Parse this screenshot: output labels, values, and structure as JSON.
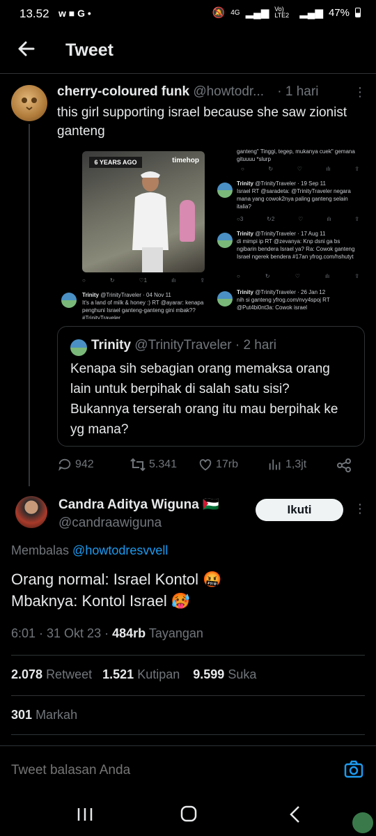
{
  "status_bar": {
    "time": "13.52",
    "left_icons": "w ■ G •",
    "network": "4G",
    "volte": "Vo) LTE2",
    "battery": "47%"
  },
  "header": {
    "title": "Tweet"
  },
  "tweet1": {
    "name": "cherry-coloured funk",
    "handle": "@howtodr...",
    "time": "· 1 hari",
    "text": "this girl supporting israel because she saw zionist ganteng"
  },
  "media": {
    "badge": "6 YEARS AGO",
    "brand": "timehop",
    "top_text": "ganteng\" Tinggi, tegep, mukanya cuek\" gemana gituuuu *slurp",
    "mini_tweets": [
      {
        "name": "Trinity",
        "handle": "@TrinityTraveler · 19 Sep 11",
        "text": "Israel RT @saradeta: @TrinityTraveler negara mana yang cowok2nya paling ganteng selain italia?"
      },
      {
        "name": "Trinity",
        "handle": "@TrinityTraveler · 17 Aug 11",
        "text": "di mimpi ip RT @zevanya: Knp dsni ga bs ngibarin bendera Israel ya? Ra: Cowok ganteng Israel ngerek bendera #17an yfrog.com/hshutyt"
      },
      {
        "name": "Trinity",
        "handle": "@TrinityTraveler · 26 Jan 12",
        "text": "nih si ganteng yfrog.com/nvy4spoj RT @Put4bi0nt3a: Cowok israel"
      },
      {
        "name": "Trinity",
        "handle": "@TrinityTraveler · 04 Nov 11",
        "text": "It's a land of milk & honey :) RT @ayarar: kenapa penghuni Israel ganteng-ganteng gini mbak?? #TrinityTraveler"
      }
    ],
    "counts": [
      "3",
      "2",
      "1"
    ]
  },
  "quote": {
    "name": "Trinity",
    "handle": "@TrinityTraveler",
    "time": "· 2 hari",
    "text": "Kenapa sih sebagian orang memaksa orang lain untuk berpihak di salah satu sisi? Bukannya terserah orang itu mau berpihak ke yg mana?"
  },
  "tweet1_actions": {
    "replies": "942",
    "retweets": "5.341",
    "likes": "17rb",
    "views": "1,3jt"
  },
  "tweet2": {
    "name": "Candra Aditya Wiguna",
    "flag": "🇵🇸",
    "handle": "@candraawiguna",
    "follow_label": "Ikuti",
    "reply_prefix": "Membalas",
    "reply_mention": "@howtodresvvell",
    "line1": "Orang normal: Israel Kontol 🤬",
    "line2": "Mbaknya: Kontol Israel 🥵",
    "time": "6:01 · 31 Okt 23 ·",
    "views": "484rb",
    "views_label": "Tayangan",
    "retweets": "2.078",
    "retweets_label": "Retweet",
    "quotes": "1.521",
    "quotes_label": "Kutipan",
    "likes": "9.599",
    "likes_label": "Suka",
    "bookmarks": "301",
    "bookmarks_label": "Markah"
  },
  "reply_bar": {
    "placeholder": "Tweet balasan Anda"
  }
}
